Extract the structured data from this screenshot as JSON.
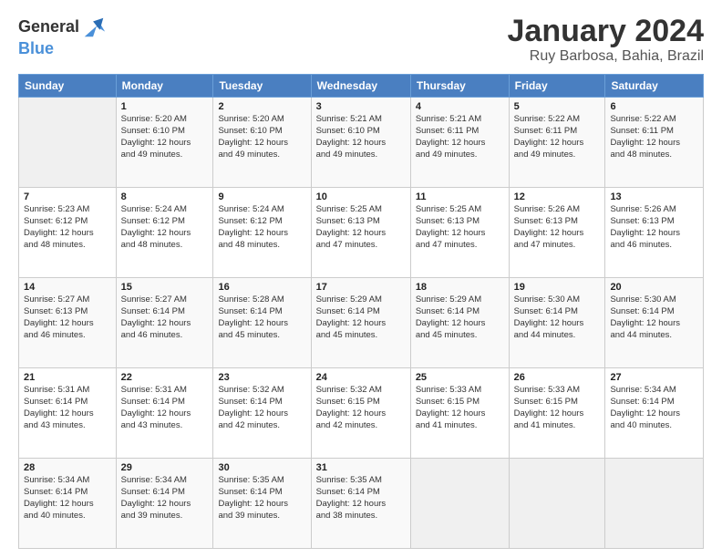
{
  "header": {
    "logo_line1": "General",
    "logo_line2": "Blue",
    "title": "January 2024",
    "subtitle": "Ruy Barbosa, Bahia, Brazil"
  },
  "columns": [
    "Sunday",
    "Monday",
    "Tuesday",
    "Wednesday",
    "Thursday",
    "Friday",
    "Saturday"
  ],
  "weeks": [
    [
      {
        "day": "",
        "info": ""
      },
      {
        "day": "1",
        "info": "Sunrise: 5:20 AM\nSunset: 6:10 PM\nDaylight: 12 hours\nand 49 minutes."
      },
      {
        "day": "2",
        "info": "Sunrise: 5:20 AM\nSunset: 6:10 PM\nDaylight: 12 hours\nand 49 minutes."
      },
      {
        "day": "3",
        "info": "Sunrise: 5:21 AM\nSunset: 6:10 PM\nDaylight: 12 hours\nand 49 minutes."
      },
      {
        "day": "4",
        "info": "Sunrise: 5:21 AM\nSunset: 6:11 PM\nDaylight: 12 hours\nand 49 minutes."
      },
      {
        "day": "5",
        "info": "Sunrise: 5:22 AM\nSunset: 6:11 PM\nDaylight: 12 hours\nand 49 minutes."
      },
      {
        "day": "6",
        "info": "Sunrise: 5:22 AM\nSunset: 6:11 PM\nDaylight: 12 hours\nand 48 minutes."
      }
    ],
    [
      {
        "day": "7",
        "info": "Sunrise: 5:23 AM\nSunset: 6:12 PM\nDaylight: 12 hours\nand 48 minutes."
      },
      {
        "day": "8",
        "info": "Sunrise: 5:24 AM\nSunset: 6:12 PM\nDaylight: 12 hours\nand 48 minutes."
      },
      {
        "day": "9",
        "info": "Sunrise: 5:24 AM\nSunset: 6:12 PM\nDaylight: 12 hours\nand 48 minutes."
      },
      {
        "day": "10",
        "info": "Sunrise: 5:25 AM\nSunset: 6:13 PM\nDaylight: 12 hours\nand 47 minutes."
      },
      {
        "day": "11",
        "info": "Sunrise: 5:25 AM\nSunset: 6:13 PM\nDaylight: 12 hours\nand 47 minutes."
      },
      {
        "day": "12",
        "info": "Sunrise: 5:26 AM\nSunset: 6:13 PM\nDaylight: 12 hours\nand 47 minutes."
      },
      {
        "day": "13",
        "info": "Sunrise: 5:26 AM\nSunset: 6:13 PM\nDaylight: 12 hours\nand 46 minutes."
      }
    ],
    [
      {
        "day": "14",
        "info": "Sunrise: 5:27 AM\nSunset: 6:13 PM\nDaylight: 12 hours\nand 46 minutes."
      },
      {
        "day": "15",
        "info": "Sunrise: 5:27 AM\nSunset: 6:14 PM\nDaylight: 12 hours\nand 46 minutes."
      },
      {
        "day": "16",
        "info": "Sunrise: 5:28 AM\nSunset: 6:14 PM\nDaylight: 12 hours\nand 45 minutes."
      },
      {
        "day": "17",
        "info": "Sunrise: 5:29 AM\nSunset: 6:14 PM\nDaylight: 12 hours\nand 45 minutes."
      },
      {
        "day": "18",
        "info": "Sunrise: 5:29 AM\nSunset: 6:14 PM\nDaylight: 12 hours\nand 45 minutes."
      },
      {
        "day": "19",
        "info": "Sunrise: 5:30 AM\nSunset: 6:14 PM\nDaylight: 12 hours\nand 44 minutes."
      },
      {
        "day": "20",
        "info": "Sunrise: 5:30 AM\nSunset: 6:14 PM\nDaylight: 12 hours\nand 44 minutes."
      }
    ],
    [
      {
        "day": "21",
        "info": "Sunrise: 5:31 AM\nSunset: 6:14 PM\nDaylight: 12 hours\nand 43 minutes."
      },
      {
        "day": "22",
        "info": "Sunrise: 5:31 AM\nSunset: 6:14 PM\nDaylight: 12 hours\nand 43 minutes."
      },
      {
        "day": "23",
        "info": "Sunrise: 5:32 AM\nSunset: 6:14 PM\nDaylight: 12 hours\nand 42 minutes."
      },
      {
        "day": "24",
        "info": "Sunrise: 5:32 AM\nSunset: 6:15 PM\nDaylight: 12 hours\nand 42 minutes."
      },
      {
        "day": "25",
        "info": "Sunrise: 5:33 AM\nSunset: 6:15 PM\nDaylight: 12 hours\nand 41 minutes."
      },
      {
        "day": "26",
        "info": "Sunrise: 5:33 AM\nSunset: 6:15 PM\nDaylight: 12 hours\nand 41 minutes."
      },
      {
        "day": "27",
        "info": "Sunrise: 5:34 AM\nSunset: 6:14 PM\nDaylight: 12 hours\nand 40 minutes."
      }
    ],
    [
      {
        "day": "28",
        "info": "Sunrise: 5:34 AM\nSunset: 6:14 PM\nDaylight: 12 hours\nand 40 minutes."
      },
      {
        "day": "29",
        "info": "Sunrise: 5:34 AM\nSunset: 6:14 PM\nDaylight: 12 hours\nand 39 minutes."
      },
      {
        "day": "30",
        "info": "Sunrise: 5:35 AM\nSunset: 6:14 PM\nDaylight: 12 hours\nand 39 minutes."
      },
      {
        "day": "31",
        "info": "Sunrise: 5:35 AM\nSunset: 6:14 PM\nDaylight: 12 hours\nand 38 minutes."
      },
      {
        "day": "",
        "info": ""
      },
      {
        "day": "",
        "info": ""
      },
      {
        "day": "",
        "info": ""
      }
    ]
  ]
}
